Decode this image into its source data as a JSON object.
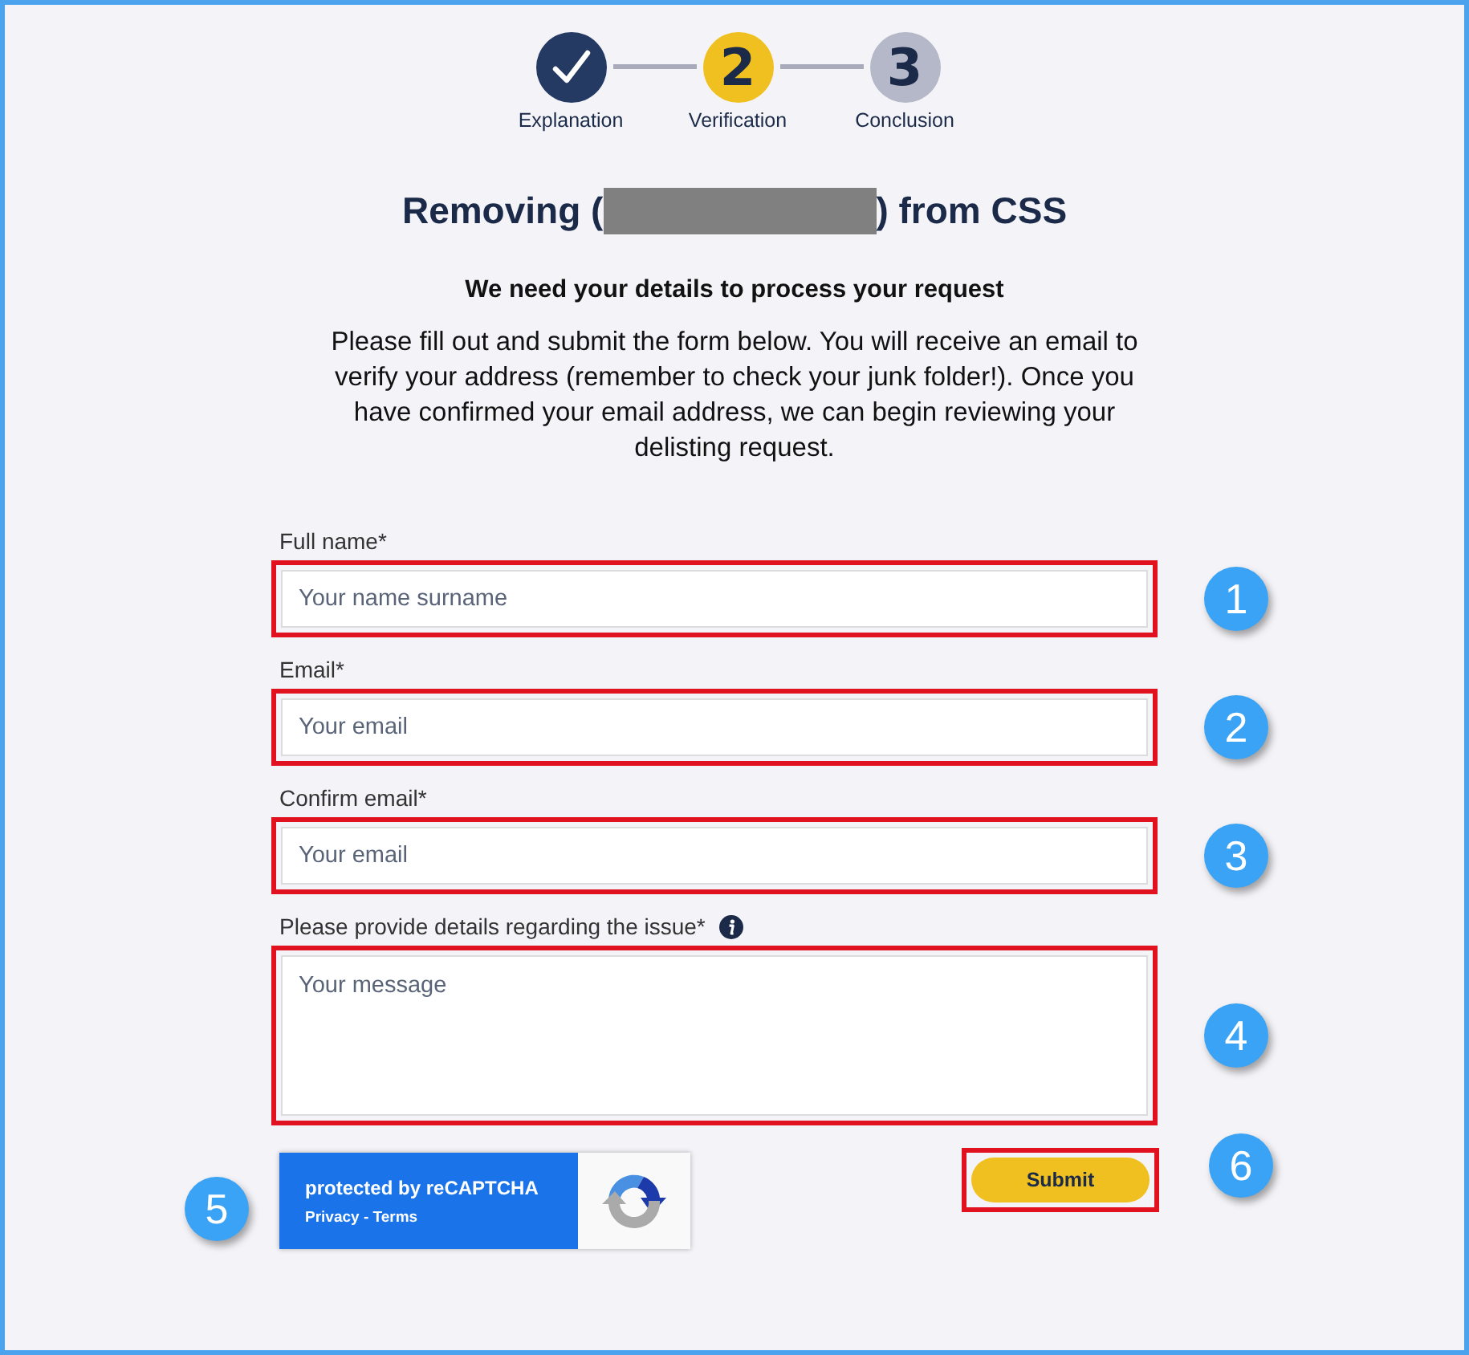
{
  "steps": [
    {
      "kind": "done",
      "label": "Explanation"
    },
    {
      "kind": "current",
      "number": "2",
      "label": "Verification"
    },
    {
      "kind": "upcoming",
      "number": "3",
      "label": "Conclusion"
    }
  ],
  "title": {
    "before": "Removing (",
    "redacted": true,
    "after": ") from CSS"
  },
  "subtitle": "We need your details to process your request",
  "intro": "Please fill out and submit the form below. You will receive an email to verify your address (remember to check your junk folder!). Once you have confirmed your email address, we can begin reviewing your delisting request.",
  "fields": [
    {
      "kind": "input",
      "label": "Full name*",
      "placeholder": "Your name surname",
      "callout": "1"
    },
    {
      "kind": "input",
      "label": "Email*",
      "placeholder": "Your email",
      "callout": "2"
    },
    {
      "kind": "input",
      "label": "Confirm email*",
      "placeholder": "Your email",
      "callout": "3"
    },
    {
      "kind": "textarea",
      "label": "Please provide details regarding the issue*",
      "info": true,
      "placeholder": "Your message",
      "callout": "4"
    }
  ],
  "captcha": {
    "title": "protected by reCAPTCHA",
    "links": "Privacy - Terms",
    "callout": "5"
  },
  "submit": {
    "label": "Submit",
    "callout": "6"
  }
}
